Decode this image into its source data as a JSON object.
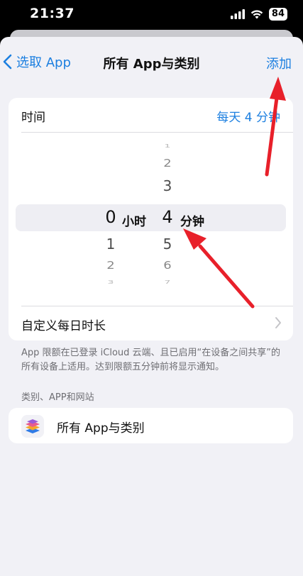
{
  "status_bar": {
    "time": "21:37",
    "battery": "84"
  },
  "nav": {
    "back_label": "选取 App",
    "title": "所有 App与类别",
    "add_label": "添加"
  },
  "time_row": {
    "label": "时间",
    "value": "每天 4 分钟"
  },
  "picker": {
    "hours": {
      "selected": "0",
      "unit": "小时",
      "below": [
        "1",
        "2",
        "3"
      ]
    },
    "minutes": {
      "above": [
        "1",
        "2",
        "3"
      ],
      "selected": "4",
      "unit": "分钟",
      "below": [
        "5",
        "6",
        "7"
      ]
    }
  },
  "custom_row": {
    "label": "自定义每日时长"
  },
  "footnote": "App 限额在已登录 iCloud 云端、且已启用“在设备之间共享”的所有设备上适用。达到限额五分钟前将显示通知。",
  "section_header": "类别、APP和网站",
  "apps_row": {
    "label": "所有 App与类别",
    "icon": "stack-layers-icon"
  },
  "colors": {
    "accent": "#1c7fe0",
    "background": "#f1f1f6",
    "annotation_arrow": "#e8202a"
  }
}
